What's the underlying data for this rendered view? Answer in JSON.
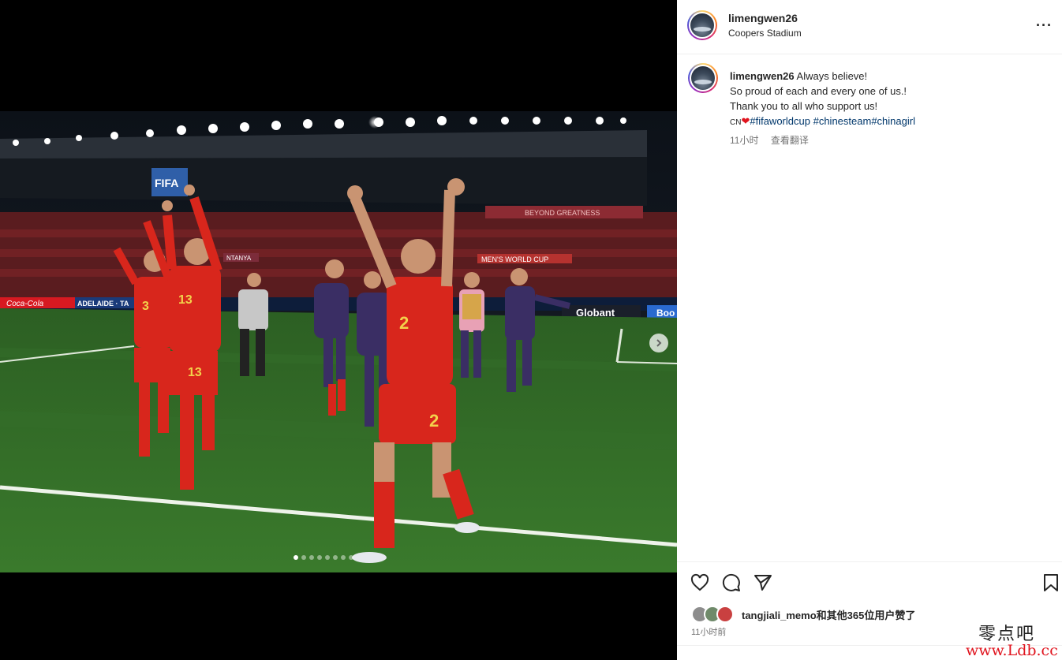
{
  "post": {
    "username": "limengwen26",
    "location": "Coopers Stadium",
    "more_label": "···"
  },
  "caption": {
    "username": "limengwen26",
    "line1": "Always believe!",
    "line2": "So proud of each and every one of us.!",
    "line3": "Thank you to all who support us!",
    "flag_text": "CN",
    "heart": "❤",
    "hashtags": [
      "#fifaworldcup",
      "#chinesteam",
      "#chinagirl"
    ],
    "time": "11小时",
    "translate": "查看翻译"
  },
  "media": {
    "slide_count": 8,
    "active_slide": 1,
    "signage": {
      "fifa": "FIFA",
      "coca_cola": "Coca-Cola",
      "adelaide": "ADELAIDE · TA",
      "globant": "Globant",
      "boo": "Boo",
      "womens_world_cup": "MEN'S WORLD CUP",
      "beyond": "BEYOND GREATNESS",
      "ntanya": "NTANYA"
    }
  },
  "footer": {
    "likes_text": "tangjiali_memo和其他365位用户赞了",
    "time": "11小时前"
  },
  "watermark": {
    "cn": "零点吧",
    "url": "www.Ldb.cc"
  },
  "colors": {
    "hashtag": "#00376b",
    "secondary": "#737373",
    "jersey_red": "#d8261c",
    "pitch": "#2f6a25"
  }
}
